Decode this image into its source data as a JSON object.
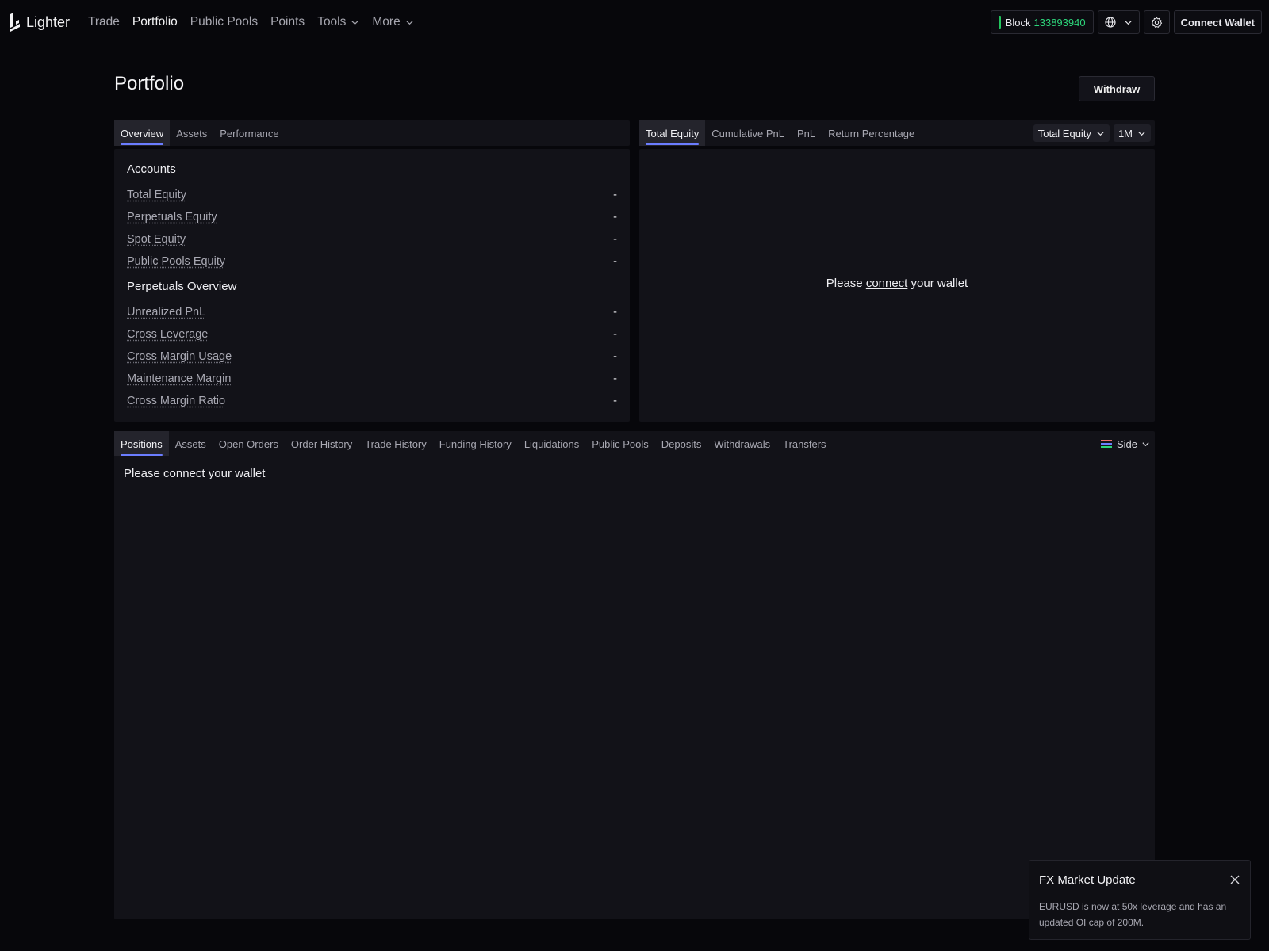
{
  "app": {
    "name": "Lighter"
  },
  "nav": {
    "items": [
      {
        "label": "Trade"
      },
      {
        "label": "Portfolio"
      },
      {
        "label": "Public Pools"
      },
      {
        "label": "Points"
      },
      {
        "label": "Tools"
      },
      {
        "label": "More"
      }
    ]
  },
  "header": {
    "block_label": "Block",
    "block_number": "133893940",
    "connect_wallet": "Connect Wallet"
  },
  "page": {
    "title": "Portfolio",
    "withdraw_label": "Withdraw"
  },
  "overview": {
    "tabs": [
      "Overview",
      "Assets",
      "Performance"
    ],
    "accounts_title": "Accounts",
    "accounts": [
      {
        "label": "Total Equity",
        "value": "-"
      },
      {
        "label": "Perpetuals Equity",
        "value": "-"
      },
      {
        "label": "Spot Equity",
        "value": "-"
      },
      {
        "label": "Public Pools Equity",
        "value": "-"
      }
    ],
    "perps_title": "Perpetuals Overview",
    "perps": [
      {
        "label": "Unrealized PnL",
        "value": "-"
      },
      {
        "label": "Cross Leverage",
        "value": "-"
      },
      {
        "label": "Cross Margin Usage",
        "value": "-"
      },
      {
        "label": "Maintenance Margin",
        "value": "-"
      },
      {
        "label": "Cross Margin Ratio",
        "value": "-"
      }
    ]
  },
  "chart_panel": {
    "tabs": [
      "Total Equity",
      "Cumulative PnL",
      "PnL",
      "Return Percentage"
    ],
    "metric_select": "Total Equity",
    "range_select": "1M",
    "msg_before": "Please",
    "msg_link": "connect",
    "msg_after": "your wallet"
  },
  "bottom": {
    "tabs": [
      "Positions",
      "Assets",
      "Open Orders",
      "Order History",
      "Trade History",
      "Funding History",
      "Liquidations",
      "Public Pools",
      "Deposits",
      "Withdrawals",
      "Transfers"
    ],
    "side_label": "Side",
    "msg_before": "Please",
    "msg_link": "connect",
    "msg_after": "your wallet"
  },
  "toast": {
    "title": "FX Market Update",
    "body": "EURUSD is now at 50x leverage and has an updated OI cap of 200M."
  },
  "colors": {
    "accent": "#6b7dff",
    "block_green": "#2dd47a",
    "background": "#07070b",
    "panel": "#121218"
  }
}
